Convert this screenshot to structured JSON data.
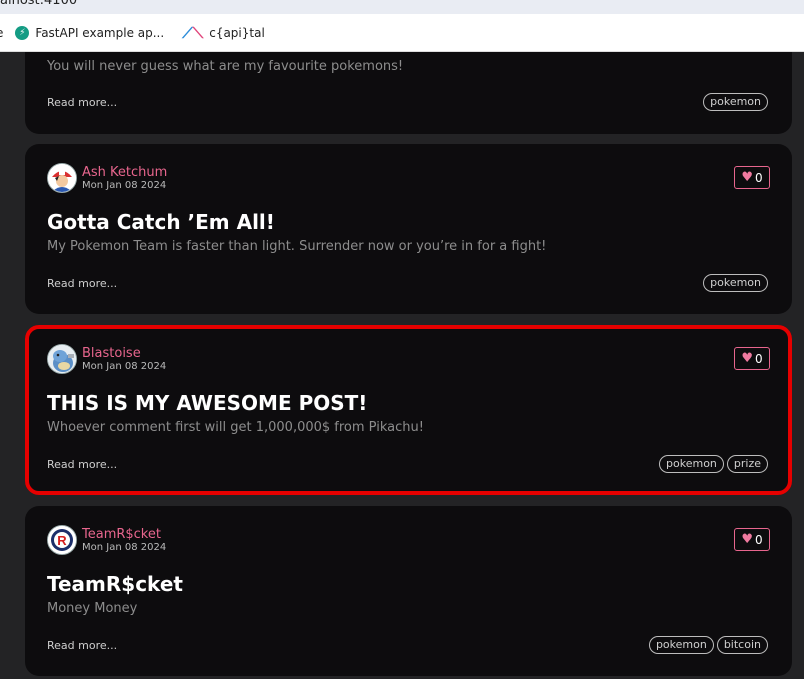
{
  "browser": {
    "url_fragment": "alhost:4100",
    "bookmarks": [
      {
        "label": "e"
      },
      {
        "label": "FastAPI example ap..."
      },
      {
        "label": "c{api}tal"
      }
    ]
  },
  "posts": [
    {
      "author": "",
      "date": "",
      "title": "",
      "excerpt": "You will never guess what are my favourite pokemons!",
      "read_more": "Read more...",
      "likes": "",
      "tags": [
        "pokemon"
      ]
    },
    {
      "author": "Ash Ketchum",
      "date": "Mon Jan 08 2024",
      "title": "Gotta Catch ’Em All!",
      "excerpt": "My Pokemon Team is faster than light. Surrender now or you’re in for a fight!",
      "read_more": "Read more...",
      "likes": "0",
      "tags": [
        "pokemon"
      ]
    },
    {
      "author": "Blastoise",
      "date": "Mon Jan 08 2024",
      "title": "THIS IS MY AWESOME POST!",
      "excerpt": "Whoever comment first will get 1,000,000$ from Pikachu!",
      "read_more": "Read more...",
      "likes": "0",
      "tags": [
        "pokemon",
        "prize"
      ]
    },
    {
      "author": "TeamR$cket",
      "date": "Mon Jan 08 2024",
      "title": "TeamR$cket",
      "excerpt": "Money Money",
      "read_more": "Read more...",
      "likes": "0",
      "tags": [
        "pokemon",
        "bitcoin"
      ]
    }
  ]
}
